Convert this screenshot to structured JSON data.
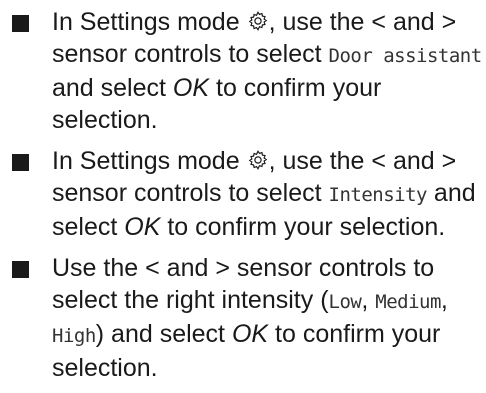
{
  "steps": [
    {
      "parts": [
        "In Settings mode ",
        "{gear}",
        ", use the ",
        "<",
        " and ",
        ">",
        " sensor controls to select ",
        "Door assistant",
        " and select ",
        "OK",
        " to confirm your selection."
      ]
    },
    {
      "parts": [
        "In Settings mode ",
        "{gear}",
        ", use the ",
        "<",
        " and ",
        ">",
        " sensor controls to select ",
        "Intensity",
        " and select ",
        "OK",
        " to confirm your selection."
      ]
    },
    {
      "parts": [
        "Use the ",
        "<",
        " and ",
        ">",
        " sensor controls to select the right intensity (",
        "Low",
        ", ",
        "Medium",
        ", ",
        "High",
        ") and select ",
        "OK",
        " to confirm your selection."
      ]
    }
  ],
  "icons": {
    "gear": "settings-gear-icon",
    "bullet": "square-bullet"
  },
  "colors": {
    "text": "#1a1a1a",
    "display_text": "#333333"
  }
}
